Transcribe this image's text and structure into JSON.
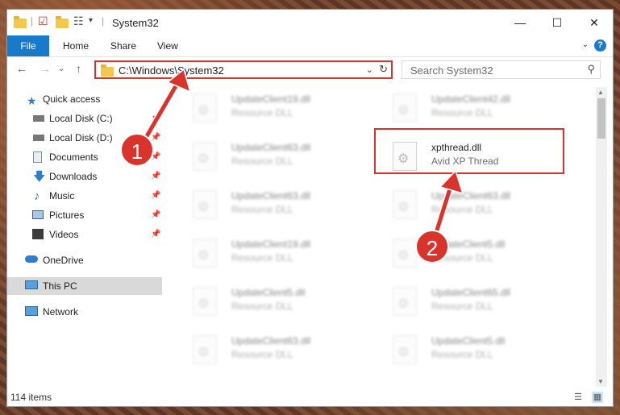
{
  "window": {
    "title": "System32",
    "controls": {
      "minimize": "—",
      "maximize": "☐",
      "close": "✕"
    }
  },
  "ribbon": {
    "tabs": [
      "File",
      "Home",
      "Share",
      "View"
    ],
    "help": "?",
    "expand": "⌄"
  },
  "navigation": {
    "back": "←",
    "forward": "→",
    "up": "↑",
    "recent": "⌄",
    "address": "C:\\Windows\\System32",
    "address_dropdown": "⌄",
    "refresh": "↻",
    "search_placeholder": "Search System32"
  },
  "sidebar": {
    "items": [
      {
        "label": "Quick access",
        "icon": "star-icon"
      },
      {
        "label": "Local Disk (C:)",
        "icon": "drive-icon",
        "pinned": true
      },
      {
        "label": "Local Disk (D:)",
        "icon": "drive-icon",
        "pinned": true
      },
      {
        "label": "Documents",
        "icon": "documents-icon",
        "pinned": true
      },
      {
        "label": "Downloads",
        "icon": "downloads-icon",
        "pinned": true
      },
      {
        "label": "Music",
        "icon": "music-icon",
        "pinned": true
      },
      {
        "label": "Pictures",
        "icon": "pictures-icon",
        "pinned": true
      },
      {
        "label": "Videos",
        "icon": "videos-icon",
        "pinned": true
      },
      {
        "label": "OneDrive",
        "icon": "onedrive-icon"
      },
      {
        "label": "This PC",
        "icon": "pc-icon",
        "selected": true
      },
      {
        "label": "Network",
        "icon": "network-icon"
      }
    ]
  },
  "files": [
    {
      "name": "UpdateClient19.dll",
      "desc": "Resource DLL"
    },
    {
      "name": "UpdateClient42.dll",
      "desc": "Resource DLL"
    },
    {
      "name": "UpdateClient63.dll",
      "desc": "Resource DLL"
    },
    {
      "name": "xpthread.dll",
      "desc": "Avid XP Thread",
      "highlighted": true
    },
    {
      "name": "UpdateClient63.dll",
      "desc": "Resource DLL"
    },
    {
      "name": "UpdateClient63.dll",
      "desc": "Resource DLL"
    },
    {
      "name": "UpdateClient19.dll",
      "desc": "Resource DLL"
    },
    {
      "name": "UpdateClient5.dll",
      "desc": "Resource DLL"
    },
    {
      "name": "UpdateClient5.dll",
      "desc": "Resource DLL"
    },
    {
      "name": "UpdateClient65.dll",
      "desc": "Resource DLL"
    },
    {
      "name": "UpdateClient63.dll",
      "desc": "Resource DLL"
    },
    {
      "name": "UpdateClient5.dll",
      "desc": "Resource DLL"
    }
  ],
  "status": {
    "count": "114 items"
  },
  "annotations": {
    "step1": "1",
    "step2": "2",
    "color": "#d9342b"
  }
}
